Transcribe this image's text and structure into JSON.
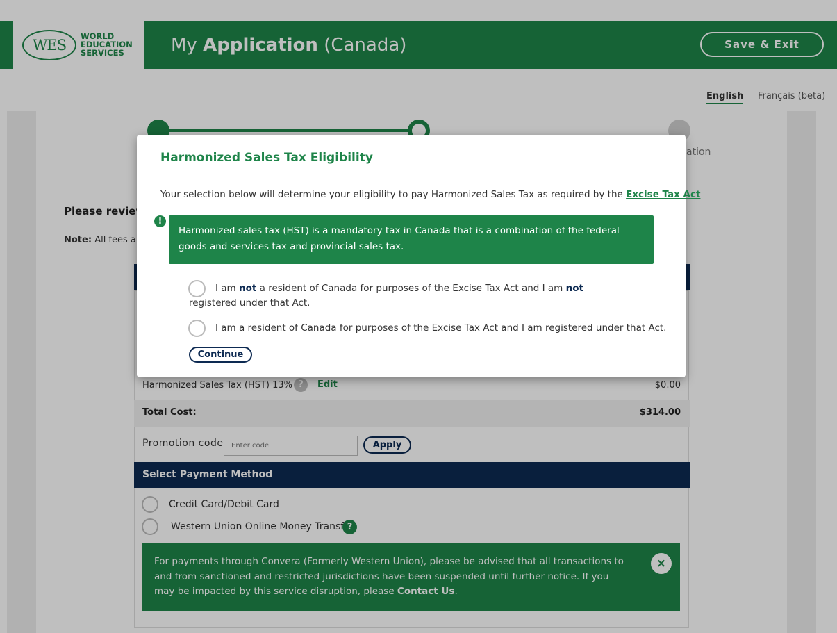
{
  "header": {
    "logo_mark": "WES",
    "logo_lines": [
      "WORLD",
      "EDUCATION",
      "SERVICES"
    ],
    "title_prefix": "My",
    "title_bold": "Application",
    "title_suffix": "(Canada)",
    "save_exit": "Save & Exit"
  },
  "language": {
    "english": "English",
    "french": "Français (beta)"
  },
  "stepper": {
    "visible_label_fragment": "ation"
  },
  "page": {
    "please_review": "Please review",
    "note_bold": "Note:",
    "note_text": "All fees are"
  },
  "cost_summary": {
    "hst_label": "Harmonized Sales Tax (HST) 13%",
    "help_mark": "?",
    "edit": "Edit",
    "hst_amount": "$0.00",
    "total_label": "Total Cost:",
    "total_amount": "$314.00"
  },
  "promo": {
    "label": "Promotion code",
    "placeholder": "Enter code",
    "apply": "Apply"
  },
  "payment": {
    "header": "Select Payment Method",
    "options": [
      "Credit Card/Debit Card",
      "Western Union Online Money Transfer"
    ],
    "help_mark": "?",
    "alert_text": "For payments through Convera (Formerly Western Union), please be advised that all transactions to and from sanctioned and restricted jurisdictions have been suspended until further notice. If you may be impacted by this service disruption, please ",
    "alert_link": "Contact Us",
    "alert_end": ".",
    "close_mark": "×"
  },
  "modal": {
    "title": "Harmonized Sales Tax Eligibility",
    "intro": "Your selection below will determine your eligibility to pay Harmonized Sales Tax as required by the ",
    "intro_link": "Excise Tax Act",
    "warn_mark": "!",
    "alert": "Harmonized sales tax (HST) is a mandatory tax in Canada that is a combination of the federal goods and services tax and provincial sales tax.",
    "option1": {
      "p1": "I am ",
      "b1": "not",
      "p2": " a resident of Canada for purposes of the Excise Tax Act and I am ",
      "b2": "not",
      "p3": " registered under that Act."
    },
    "option2": "I am a resident of Canada for purposes of the Excise Tax Act and I am registered under that Act.",
    "continue": "Continue"
  }
}
